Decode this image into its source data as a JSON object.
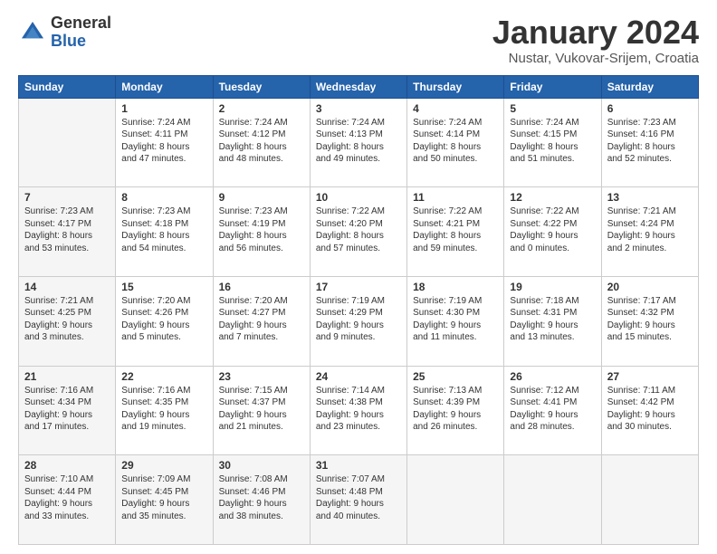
{
  "header": {
    "logo_general": "General",
    "logo_blue": "Blue",
    "month_title": "January 2024",
    "location": "Nustar, Vukovar-Srijem, Croatia"
  },
  "weekdays": [
    "Sunday",
    "Monday",
    "Tuesday",
    "Wednesday",
    "Thursday",
    "Friday",
    "Saturday"
  ],
  "weeks": [
    [
      {
        "day": "",
        "sunrise": "",
        "sunset": "",
        "daylight": ""
      },
      {
        "day": "1",
        "sunrise": "Sunrise: 7:24 AM",
        "sunset": "Sunset: 4:11 PM",
        "daylight": "Daylight: 8 hours and 47 minutes."
      },
      {
        "day": "2",
        "sunrise": "Sunrise: 7:24 AM",
        "sunset": "Sunset: 4:12 PM",
        "daylight": "Daylight: 8 hours and 48 minutes."
      },
      {
        "day": "3",
        "sunrise": "Sunrise: 7:24 AM",
        "sunset": "Sunset: 4:13 PM",
        "daylight": "Daylight: 8 hours and 49 minutes."
      },
      {
        "day": "4",
        "sunrise": "Sunrise: 7:24 AM",
        "sunset": "Sunset: 4:14 PM",
        "daylight": "Daylight: 8 hours and 50 minutes."
      },
      {
        "day": "5",
        "sunrise": "Sunrise: 7:24 AM",
        "sunset": "Sunset: 4:15 PM",
        "daylight": "Daylight: 8 hours and 51 minutes."
      },
      {
        "day": "6",
        "sunrise": "Sunrise: 7:23 AM",
        "sunset": "Sunset: 4:16 PM",
        "daylight": "Daylight: 8 hours and 52 minutes."
      }
    ],
    [
      {
        "day": "7",
        "sunrise": "Sunrise: 7:23 AM",
        "sunset": "Sunset: 4:17 PM",
        "daylight": "Daylight: 8 hours and 53 minutes."
      },
      {
        "day": "8",
        "sunrise": "Sunrise: 7:23 AM",
        "sunset": "Sunset: 4:18 PM",
        "daylight": "Daylight: 8 hours and 54 minutes."
      },
      {
        "day": "9",
        "sunrise": "Sunrise: 7:23 AM",
        "sunset": "Sunset: 4:19 PM",
        "daylight": "Daylight: 8 hours and 56 minutes."
      },
      {
        "day": "10",
        "sunrise": "Sunrise: 7:22 AM",
        "sunset": "Sunset: 4:20 PM",
        "daylight": "Daylight: 8 hours and 57 minutes."
      },
      {
        "day": "11",
        "sunrise": "Sunrise: 7:22 AM",
        "sunset": "Sunset: 4:21 PM",
        "daylight": "Daylight: 8 hours and 59 minutes."
      },
      {
        "day": "12",
        "sunrise": "Sunrise: 7:22 AM",
        "sunset": "Sunset: 4:22 PM",
        "daylight": "Daylight: 9 hours and 0 minutes."
      },
      {
        "day": "13",
        "sunrise": "Sunrise: 7:21 AM",
        "sunset": "Sunset: 4:24 PM",
        "daylight": "Daylight: 9 hours and 2 minutes."
      }
    ],
    [
      {
        "day": "14",
        "sunrise": "Sunrise: 7:21 AM",
        "sunset": "Sunset: 4:25 PM",
        "daylight": "Daylight: 9 hours and 3 minutes."
      },
      {
        "day": "15",
        "sunrise": "Sunrise: 7:20 AM",
        "sunset": "Sunset: 4:26 PM",
        "daylight": "Daylight: 9 hours and 5 minutes."
      },
      {
        "day": "16",
        "sunrise": "Sunrise: 7:20 AM",
        "sunset": "Sunset: 4:27 PM",
        "daylight": "Daylight: 9 hours and 7 minutes."
      },
      {
        "day": "17",
        "sunrise": "Sunrise: 7:19 AM",
        "sunset": "Sunset: 4:29 PM",
        "daylight": "Daylight: 9 hours and 9 minutes."
      },
      {
        "day": "18",
        "sunrise": "Sunrise: 7:19 AM",
        "sunset": "Sunset: 4:30 PM",
        "daylight": "Daylight: 9 hours and 11 minutes."
      },
      {
        "day": "19",
        "sunrise": "Sunrise: 7:18 AM",
        "sunset": "Sunset: 4:31 PM",
        "daylight": "Daylight: 9 hours and 13 minutes."
      },
      {
        "day": "20",
        "sunrise": "Sunrise: 7:17 AM",
        "sunset": "Sunset: 4:32 PM",
        "daylight": "Daylight: 9 hours and 15 minutes."
      }
    ],
    [
      {
        "day": "21",
        "sunrise": "Sunrise: 7:16 AM",
        "sunset": "Sunset: 4:34 PM",
        "daylight": "Daylight: 9 hours and 17 minutes."
      },
      {
        "day": "22",
        "sunrise": "Sunrise: 7:16 AM",
        "sunset": "Sunset: 4:35 PM",
        "daylight": "Daylight: 9 hours and 19 minutes."
      },
      {
        "day": "23",
        "sunrise": "Sunrise: 7:15 AM",
        "sunset": "Sunset: 4:37 PM",
        "daylight": "Daylight: 9 hours and 21 minutes."
      },
      {
        "day": "24",
        "sunrise": "Sunrise: 7:14 AM",
        "sunset": "Sunset: 4:38 PM",
        "daylight": "Daylight: 9 hours and 23 minutes."
      },
      {
        "day": "25",
        "sunrise": "Sunrise: 7:13 AM",
        "sunset": "Sunset: 4:39 PM",
        "daylight": "Daylight: 9 hours and 26 minutes."
      },
      {
        "day": "26",
        "sunrise": "Sunrise: 7:12 AM",
        "sunset": "Sunset: 4:41 PM",
        "daylight": "Daylight: 9 hours and 28 minutes."
      },
      {
        "day": "27",
        "sunrise": "Sunrise: 7:11 AM",
        "sunset": "Sunset: 4:42 PM",
        "daylight": "Daylight: 9 hours and 30 minutes."
      }
    ],
    [
      {
        "day": "28",
        "sunrise": "Sunrise: 7:10 AM",
        "sunset": "Sunset: 4:44 PM",
        "daylight": "Daylight: 9 hours and 33 minutes."
      },
      {
        "day": "29",
        "sunrise": "Sunrise: 7:09 AM",
        "sunset": "Sunset: 4:45 PM",
        "daylight": "Daylight: 9 hours and 35 minutes."
      },
      {
        "day": "30",
        "sunrise": "Sunrise: 7:08 AM",
        "sunset": "Sunset: 4:46 PM",
        "daylight": "Daylight: 9 hours and 38 minutes."
      },
      {
        "day": "31",
        "sunrise": "Sunrise: 7:07 AM",
        "sunset": "Sunset: 4:48 PM",
        "daylight": "Daylight: 9 hours and 40 minutes."
      },
      {
        "day": "",
        "sunrise": "",
        "sunset": "",
        "daylight": ""
      },
      {
        "day": "",
        "sunrise": "",
        "sunset": "",
        "daylight": ""
      },
      {
        "day": "",
        "sunrise": "",
        "sunset": "",
        "daylight": ""
      }
    ]
  ]
}
